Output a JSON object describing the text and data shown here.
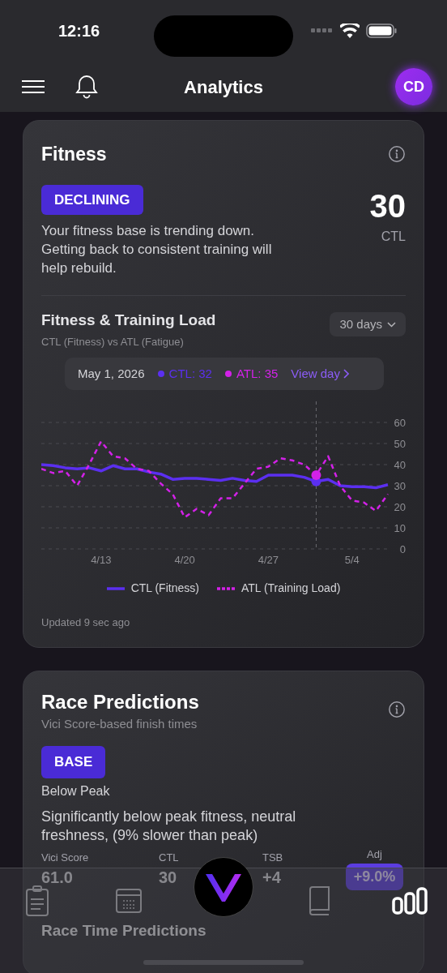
{
  "status_bar": {
    "time": "12:16"
  },
  "header": {
    "title": "Analytics",
    "avatar": "CD"
  },
  "fitness": {
    "title": "Fitness",
    "badge": "DECLINING",
    "description": "Your fitness base is trending down. Getting back to consistent training will help rebuild.",
    "value": "30",
    "value_label": "CTL",
    "chart_title": "Fitness & Training Load",
    "chart_subtitle": "CTL (Fitness) vs ATL (Fatigue)",
    "range": "30 days",
    "tooltip": {
      "date": "May 1, 2026",
      "items": [
        {
          "label": "CTL: 32",
          "color": "#5b2ff0"
        },
        {
          "label": "ATL: 35",
          "color": "#d321e8"
        }
      ],
      "link": "View day"
    },
    "chart_data": {
      "type": "line",
      "categories": [
        null,
        null,
        null,
        null,
        null,
        "4/13",
        null,
        null,
        null,
        null,
        null,
        null,
        "4/20",
        null,
        null,
        null,
        null,
        null,
        null,
        "4/27",
        null,
        null,
        null,
        null,
        null,
        null,
        "5/4",
        null,
        null,
        null
      ],
      "grid": true,
      "series": [
        {
          "name": "CTL (Fitness)",
          "color": "#5b2ff0",
          "line_style": "solid",
          "values": [
            40,
            39.5,
            38.5,
            38,
            38.5,
            37,
            39.5,
            38,
            38,
            36.5,
            35.5,
            33,
            33.5,
            33.5,
            33,
            32.5,
            33.5,
            32.5,
            32,
            35,
            35,
            35,
            34,
            32,
            33,
            30,
            29.5,
            29.5,
            29,
            30.5
          ]
        },
        {
          "name": "ATL (Training Load)",
          "color": "#d321e8",
          "line_style": "dashed",
          "values": [
            38,
            36,
            37,
            30,
            40,
            51,
            44,
            43,
            38,
            37,
            31,
            26,
            15,
            19,
            16,
            24,
            24,
            31,
            38,
            39,
            43,
            42,
            40,
            35,
            44,
            30,
            23,
            22,
            18,
            26
          ]
        }
      ],
      "ylim": [
        0,
        70
      ],
      "yticks": [
        0,
        10,
        20,
        30,
        40,
        50,
        60
      ]
    },
    "updated": "Updated 9 sec ago"
  },
  "race": {
    "title": "Race Predictions",
    "subtitle": "Vici Score-based finish times",
    "badge": "BASE",
    "status": "Below Peak",
    "description": "Significantly below peak fitness, neutral freshness, (9% slower than peak)",
    "metrics": [
      {
        "label": "Vici Score",
        "value": "61.0",
        "kind": "plain"
      },
      {
        "label": "CTL",
        "value": "30",
        "kind": "plain"
      },
      {
        "label": "TSB",
        "value": "+4",
        "kind": "plain"
      },
      {
        "label": "Adj",
        "value": "+9.0%",
        "kind": "pill"
      }
    ],
    "section": "Race Time Predictions"
  },
  "tab_bar": [
    {
      "selected": false
    },
    {
      "selected": false
    },
    {
      "selected": false
    },
    {
      "selected": false
    },
    {
      "selected": true
    }
  ]
}
